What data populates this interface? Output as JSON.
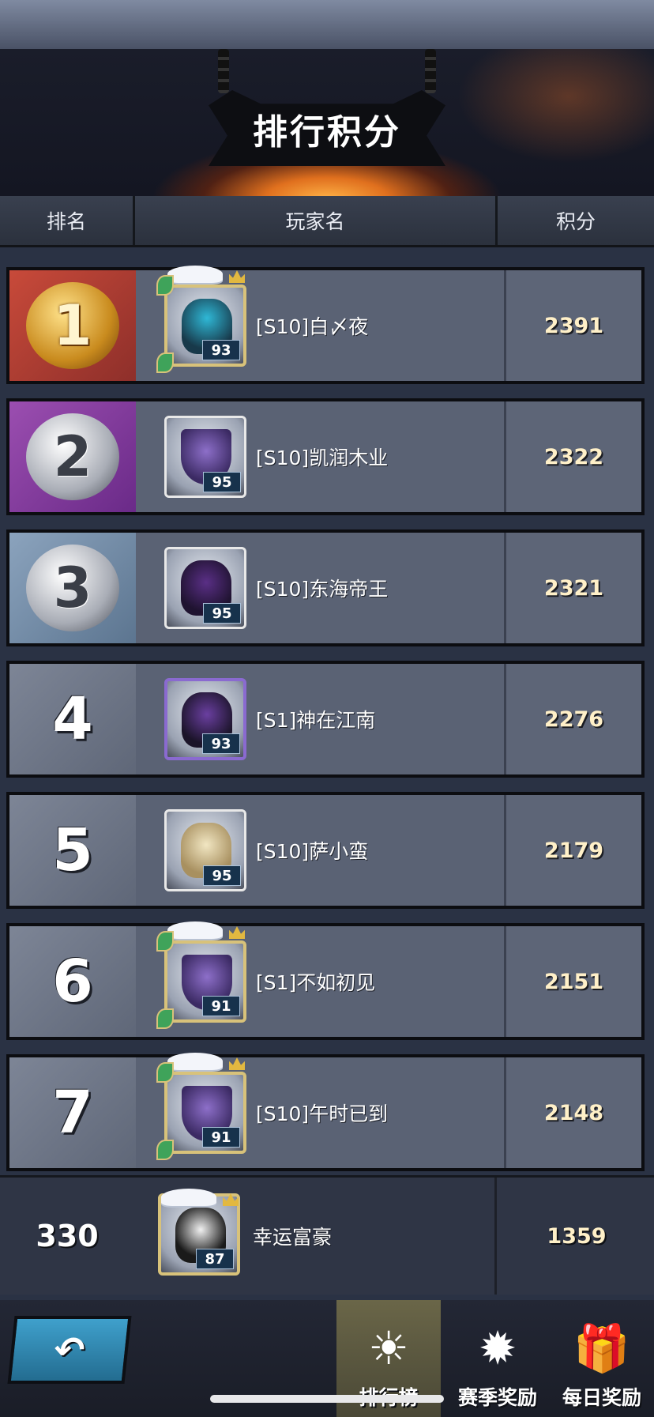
{
  "header": {
    "title": "排行积分"
  },
  "columns": {
    "rank": "排名",
    "player": "玩家名",
    "score": "积分"
  },
  "rows": [
    {
      "rank": "1",
      "name": "[S10]白〆夜",
      "level": "93",
      "score": "2391"
    },
    {
      "rank": "2",
      "name": "[S10]凯润木业",
      "level": "95",
      "score": "2322"
    },
    {
      "rank": "3",
      "name": "[S10]东海帝王",
      "level": "95",
      "score": "2321"
    },
    {
      "rank": "4",
      "name": "[S1]神在江南",
      "level": "93",
      "score": "2276"
    },
    {
      "rank": "5",
      "name": "[S10]萨小蛮",
      "level": "95",
      "score": "2179"
    },
    {
      "rank": "6",
      "name": "[S1]不如初见",
      "level": "91",
      "score": "2151"
    },
    {
      "rank": "7",
      "name": "[S10]午时已到",
      "level": "91",
      "score": "2148"
    }
  ],
  "self": {
    "rank": "330",
    "name": "幸运富豪",
    "level": "87",
    "score": "1359"
  },
  "tabs": [
    {
      "label": "排行榜",
      "icon": "sun-icon",
      "active": true
    },
    {
      "label": "赛季奖励",
      "icon": "flame-emblem-icon",
      "active": false
    },
    {
      "label": "每日奖励",
      "icon": "gift-box-icon",
      "active": false
    }
  ],
  "colors": {
    "rank1": "#c84a3a",
    "rank2": "#9b4eb0",
    "rank3": "#8ba3bd",
    "score_text": "#fff0c8",
    "back_button": "#2f8ab4"
  }
}
